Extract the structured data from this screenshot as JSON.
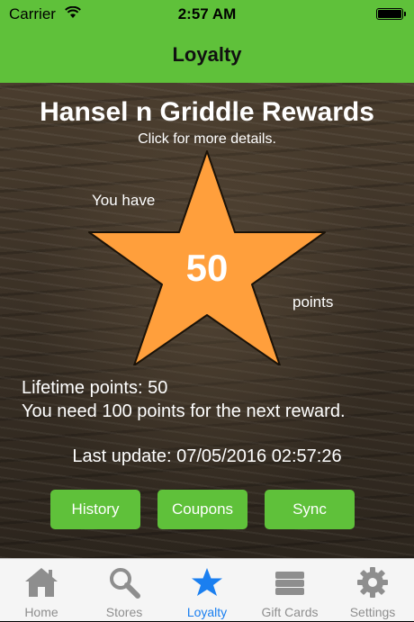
{
  "status_bar": {
    "carrier": "Carrier",
    "time": "2:57 AM"
  },
  "nav": {
    "title": "Loyalty"
  },
  "loyalty": {
    "program_title": "Hansel n Griddle Rewards",
    "details_link": "Click for more details.",
    "you_have": "You have",
    "points": "50",
    "points_label": "points",
    "lifetime": "Lifetime points: 50",
    "next_reward": "You need 100 points for the next reward.",
    "last_update": "Last update: 07/05/2016 02:57:26"
  },
  "buttons": {
    "history": "History",
    "coupons": "Coupons",
    "sync": "Sync"
  },
  "tabs": [
    {
      "label": "Home",
      "icon": "home-icon",
      "active": false
    },
    {
      "label": "Stores",
      "icon": "search-icon",
      "active": false
    },
    {
      "label": "Loyalty",
      "icon": "star-icon",
      "active": true
    },
    {
      "label": "Gift Cards",
      "icon": "gift-card-icon",
      "active": false
    },
    {
      "label": "Settings",
      "icon": "gear-icon",
      "active": false
    }
  ],
  "colors": {
    "accent_green": "#5fc13a",
    "star_orange": "#ff9f3c",
    "active_tab_blue": "#1a7ff0",
    "inactive_tab_gray": "#8e8e8e"
  }
}
